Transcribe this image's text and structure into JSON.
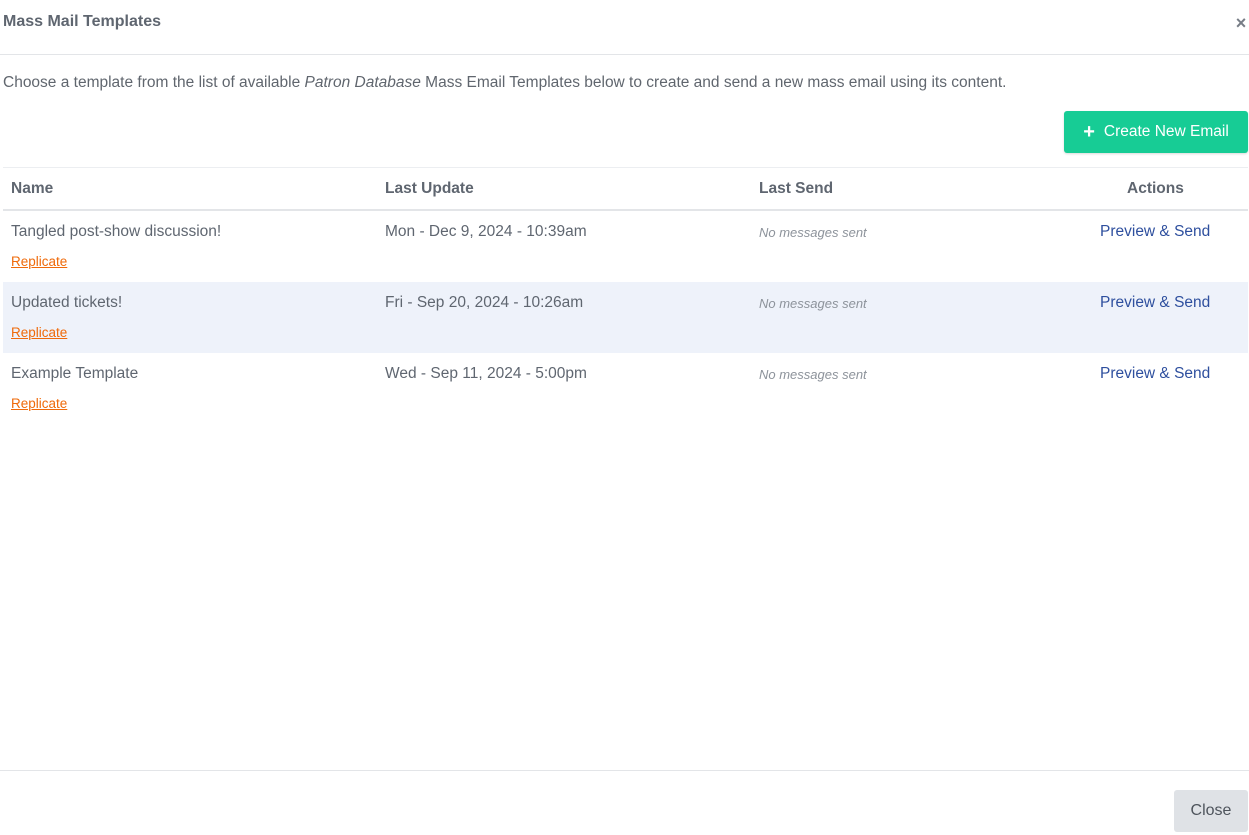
{
  "modal": {
    "title": "Mass Mail Templates",
    "close_icon": "×"
  },
  "intro": {
    "before": "Choose a template from the list of available ",
    "emphasis": "Patron Database",
    "after": " Mass Email Templates below to create and send a new mass email using its content."
  },
  "toolbar": {
    "create_icon": "+",
    "create_label": "Create New Email",
    "accent_color": "#17cc95"
  },
  "table": {
    "headers": {
      "name": "Name",
      "last_update": "Last Update",
      "last_send": "Last Send",
      "actions": "Actions"
    },
    "rows": [
      {
        "name": "Tangled post-show discussion!",
        "replicate": "Replicate",
        "last_update": "Mon - Dec 9, 2024 - 10:39am",
        "last_send": "No messages sent",
        "action": "Preview & Send"
      },
      {
        "name": "Updated tickets!",
        "replicate": "Replicate",
        "last_update": "Fri - Sep 20, 2024 - 10:26am",
        "last_send": "No messages sent",
        "action": "Preview & Send"
      },
      {
        "name": "Example Template",
        "replicate": "Replicate",
        "last_update": "Wed - Sep 11, 2024 - 5:00pm",
        "last_send": "No messages sent",
        "action": "Preview & Send"
      }
    ]
  },
  "footer": {
    "close_label": "Close"
  }
}
